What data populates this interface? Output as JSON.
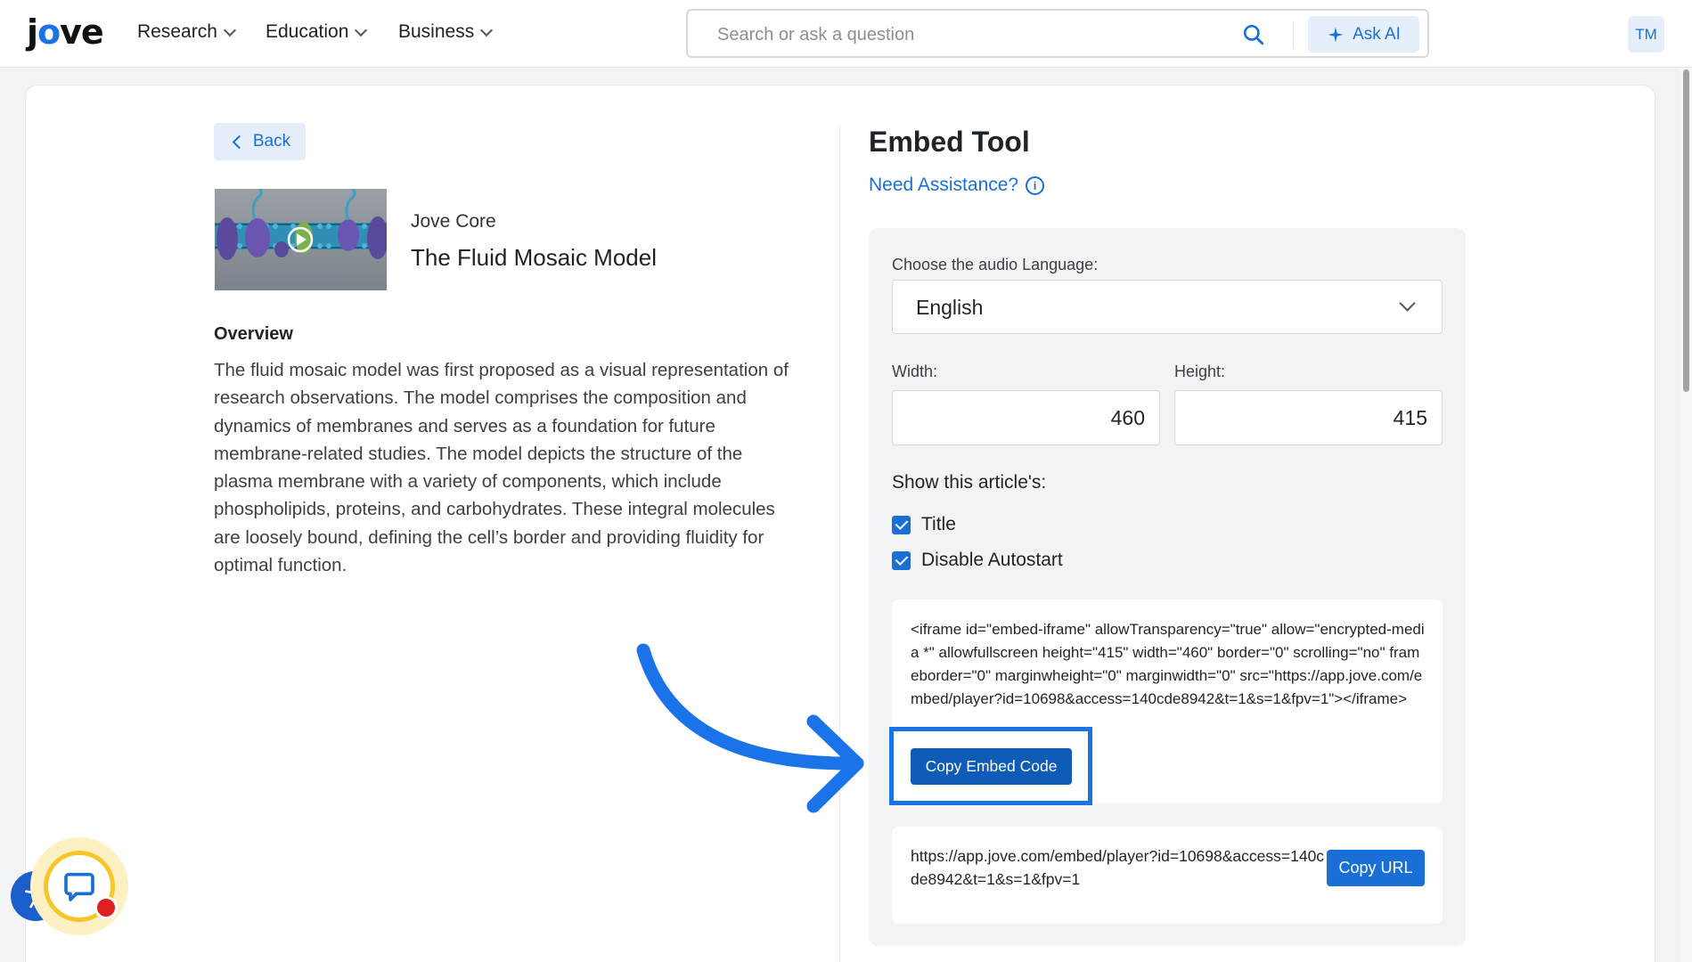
{
  "header": {
    "logo": {
      "pre": "j",
      "mid": "o",
      "post": "ve"
    },
    "nav": [
      {
        "label": "Research"
      },
      {
        "label": "Education"
      },
      {
        "label": "Business"
      }
    ],
    "search": {
      "placeholder": "Search or ask a question"
    },
    "ask_ai_label": "Ask AI",
    "user_initials": "TM"
  },
  "left": {
    "back_label": "Back",
    "course": "Jove Core",
    "video_title": "The Fluid Mosaic Model",
    "overview_heading": "Overview",
    "overview_text": "The fluid mosaic model was first proposed as a visual representation of research observations. The model comprises the composition and dynamics of membranes and serves as a foundation for future membrane-related studies. The model depicts the structure of the plasma membrane with a variety of components, which include phospholipids, proteins, and carbohydrates. These integral molecules are loosely bound, defining the cell’s border and providing fluidity for optimal function."
  },
  "embed": {
    "title": "Embed Tool",
    "assist_label": "Need Assistance?",
    "audio_label": "Choose the audio Language:",
    "audio_value": "English",
    "width_label": "Width:",
    "width_value": "460",
    "height_label": "Height:",
    "height_value": "415",
    "show_heading": "Show this article's:",
    "options": [
      {
        "label": "Title",
        "checked": true
      },
      {
        "label": "Disable Autostart",
        "checked": true
      }
    ],
    "code": "<iframe id=\"embed-iframe\" allowTransparency=\"true\" allow=\"encrypted-media *\" allowfullscreen height=\"415\" width=\"460\" border=\"0\" scrolling=\"no\" frameborder=\"0\" marginwheight=\"0\" marginwidth=\"0\" src=\"https://app.jove.com/embed/player?id=10698&access=140cde8942&t=1&s=1&fpv=1\"></iframe>",
    "copy_embed_label": "Copy Embed Code",
    "url": "https://app.jove.com/embed/player?id=10698&access=140cde8942&t=1&s=1&fpv=1",
    "copy_url_label": "Copy URL"
  },
  "colors": {
    "accent": "#1a6fd6",
    "highlight": "#1a73e8",
    "primary_button": "#0f5bb8"
  }
}
